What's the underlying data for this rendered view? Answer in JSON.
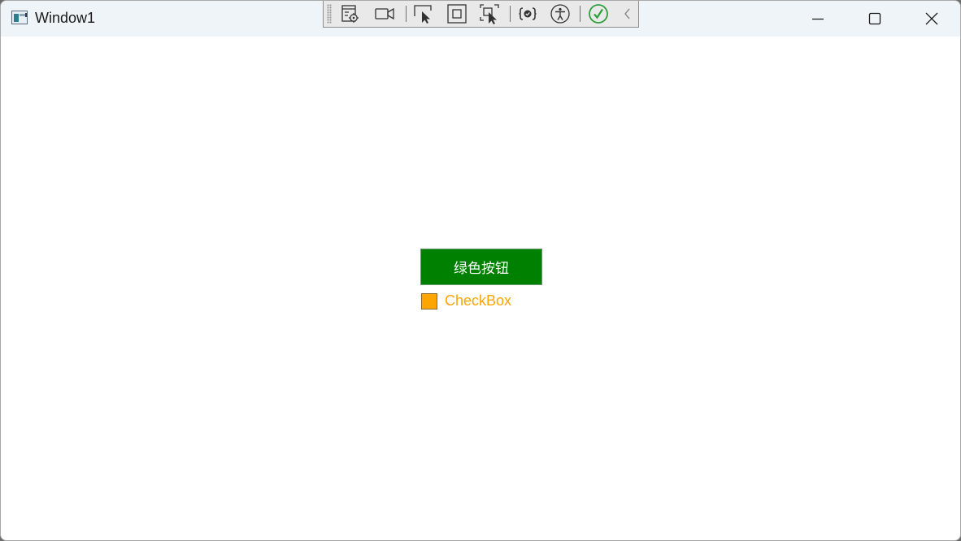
{
  "window": {
    "title": "Window1",
    "controls": {
      "minimize": "minimize",
      "maximize": "maximize",
      "close": "close"
    }
  },
  "devbar": {
    "tools": [
      {
        "name": "go-to-live-visual-tree-icon"
      },
      {
        "name": "record-icon"
      },
      {
        "name": "select-element-icon"
      },
      {
        "name": "display-layout-adorners-icon"
      },
      {
        "name": "track-focused-element-icon"
      },
      {
        "name": "binding-failures-icon"
      },
      {
        "name": "accessibility-scan-icon"
      },
      {
        "name": "check-passed-icon"
      },
      {
        "name": "collapse-toolbar-icon"
      }
    ]
  },
  "content": {
    "green_button_label": "绿色按钮",
    "checkbox_label": "CheckBox",
    "checkbox_checked": false
  },
  "colors": {
    "titlebar": "#eff4f9",
    "button_bg": "#008000",
    "button_text": "#ffffff",
    "checkbox": "#ffa500",
    "accent_check": "#2e9e3a"
  }
}
